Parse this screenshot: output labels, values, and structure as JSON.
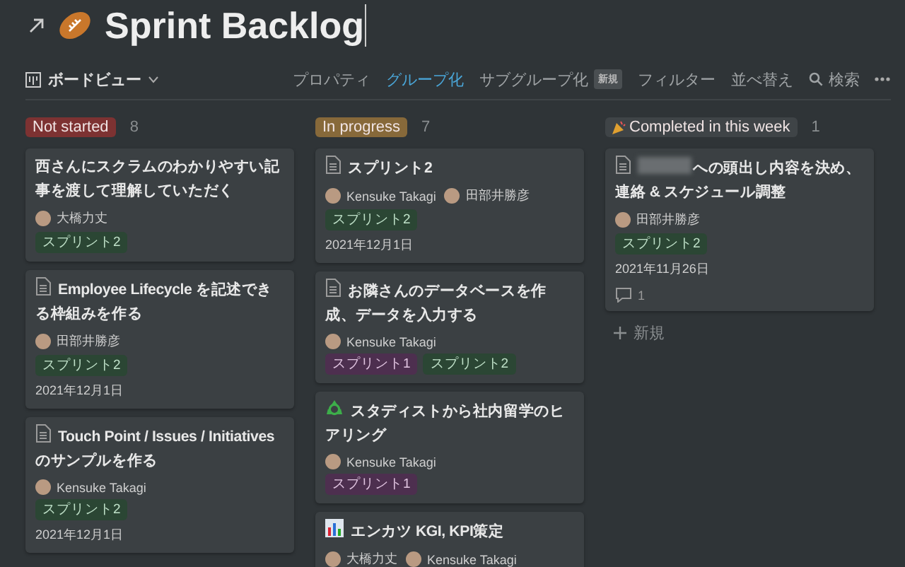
{
  "page": {
    "title": "Sprint Backlog"
  },
  "toolbar": {
    "view": "ボードビュー",
    "items": [
      {
        "label": "プロパティ",
        "selected": false
      },
      {
        "label": "グループ化",
        "selected": true
      },
      {
        "label": "サブグループ化",
        "selected": false,
        "badge": "新規"
      },
      {
        "label": "フィルター",
        "selected": false
      },
      {
        "label": "並べ替え",
        "selected": false
      },
      {
        "label": "検索",
        "selected": false,
        "kind": "search"
      }
    ]
  },
  "columns": [
    {
      "label": "Not started",
      "count": "8",
      "color": "#7d3232",
      "kind": "plain",
      "cards": [
        {
          "kind": "plain",
          "title": "西さんにスクラムのわかりやすい記事を渡して理解していただく",
          "people": [
            "大橋力丈"
          ],
          "tags": [
            {
              "label": "スプリント2",
              "color": "#2b4634"
            }
          ]
        },
        {
          "kind": "page",
          "title": "Employee Lifecycle を記述できる枠組みを作る",
          "people": [
            "田部井勝彦"
          ],
          "tags": [
            {
              "label": "スプリント2",
              "color": "#2b4634"
            }
          ],
          "date": "2021年12月1日"
        },
        {
          "kind": "page",
          "title": "Touch Point / Issues / Initiatives のサンプルを作る",
          "people": [
            "Kensuke Takagi"
          ],
          "tags": [
            {
              "label": "スプリント2",
              "color": "#2b4634"
            }
          ],
          "date": "2021年12月1日"
        }
      ]
    },
    {
      "label": "In progress",
      "count": "7",
      "color": "#87693a",
      "kind": "plain",
      "cards": [
        {
          "kind": "page",
          "title": "スプリント2",
          "people": [
            "Kensuke Takagi",
            "田部井勝彦"
          ],
          "tags": [
            {
              "label": "スプリント2",
              "color": "#2b4634"
            }
          ],
          "date": "2021年12月1日"
        },
        {
          "kind": "page",
          "title": "お隣さんのデータベースを作成、データを入力する",
          "people": [
            "Kensuke Takagi"
          ],
          "tags": [
            {
              "label": "スプリント1",
              "color": "#4d2f4f"
            },
            {
              "label": "スプリント2",
              "color": "#2b4634"
            }
          ]
        },
        {
          "kind": "recycle",
          "title": "スタディストから社内留学のヒアリング",
          "people": [
            "Kensuke Takagi"
          ],
          "tags": [
            {
              "label": "スプリント1",
              "color": "#4d2f4f"
            }
          ]
        },
        {
          "kind": "chart",
          "title": "エンカツ KGI, KPI策定",
          "people": [
            "大橋力丈",
            "Kensuke Takagi"
          ]
        }
      ]
    },
    {
      "label": "Completed in this week",
      "count": "1",
      "color": "#3f4447",
      "kind": "party",
      "cards": [
        {
          "kind": "page",
          "redacted": true,
          "title": "への頭出し内容を決め、連絡 & スケジュール調整",
          "people": [
            "田部井勝彦"
          ],
          "tags": [
            {
              "label": "スプリント2",
              "color": "#2b4634"
            }
          ],
          "date": "2021年11月26日",
          "comments": "1"
        }
      ],
      "add_label": "新規"
    }
  ]
}
